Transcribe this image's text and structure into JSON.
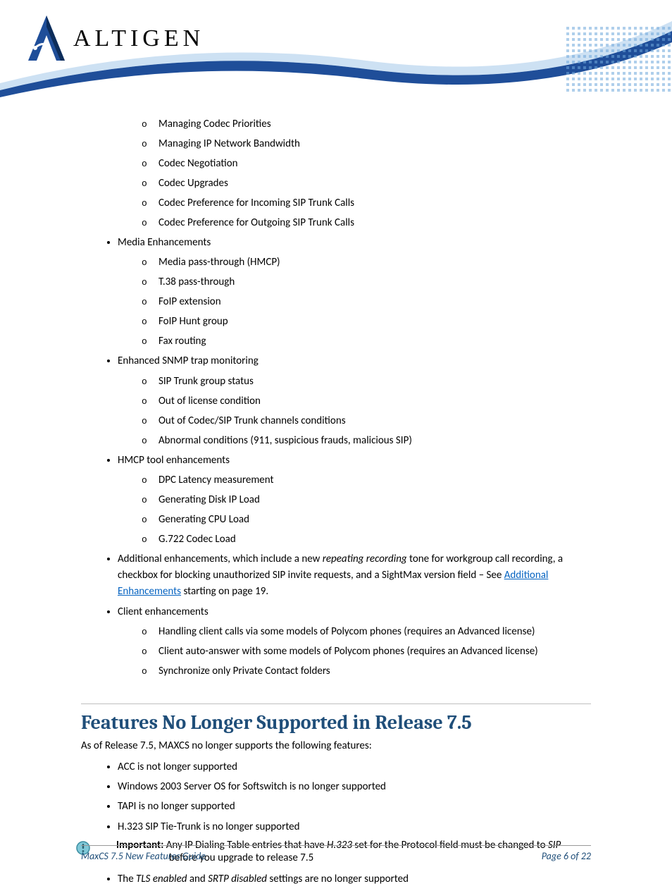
{
  "logo": {
    "text": "ALTIGEN"
  },
  "list1_sub": [
    "Managing Codec Priorities",
    "Managing IP Network Bandwidth",
    "Codec Negotiation",
    "Codec Upgrades",
    "Codec Preference for Incoming SIP Trunk Calls",
    "Codec Preference for Outgoing SIP Trunk Calls"
  ],
  "media": {
    "title": "Media Enhancements",
    "sub": [
      "Media pass-through (HMCP)",
      "T.38 pass-through",
      "FoIP extension",
      "FoIP Hunt group",
      "Fax routing"
    ]
  },
  "snmp": {
    "title": "Enhanced SNMP trap monitoring",
    "sub": [
      "SIP Trunk group status",
      "Out of license condition",
      "Out of Codec/SIP Trunk channels conditions",
      "Abnormal conditions (911, suspicious frauds, malicious SIP)"
    ]
  },
  "hmcp": {
    "title": "HMCP tool enhancements",
    "sub": [
      "DPC Latency measurement",
      "Generating Disk IP Load",
      "Generating CPU Load",
      "G.722 Codec Load"
    ]
  },
  "additional": {
    "pre": "Additional enhancements, which include a new ",
    "ital1": "repeating recording",
    "mid": " tone for workgroup call recording, a checkbox for blocking unauthorized SIP invite requests, and a SightMax version field – See ",
    "link": "Additional Enhancements",
    "post": " starting on page 19."
  },
  "client": {
    "title": "Client enhancements",
    "sub": [
      "Handling client calls via some models of Polycom phones (requires an Advanced license)",
      "Client auto-answer with some models of Polycom phones (requires an Advanced license)",
      "Synchronize only Private Contact folders"
    ]
  },
  "section2": {
    "heading": "Features No Longer Supported in Release 7.5",
    "intro": "As of Release 7.5, MAXCS no longer supports the following features:",
    "items_simple": [
      "ACC is not longer supported",
      "Windows 2003 Server OS for Softswitch is no longer supported",
      "TAPI is no longer supported",
      "H.323 SIP Tie-Trunk is no longer supported"
    ],
    "important": {
      "label": "Important:",
      "pre": "  Any IP Dialing Table entries that have ",
      "ital1": "H.323",
      "mid": " set for the Protocol field must be changed to ",
      "ital2": "SIP",
      "post": " before you upgrade to release 7.5"
    },
    "tls": {
      "pre": "The ",
      "ital1": "TLS enabled",
      "mid": " and ",
      "ital2": "SRTP disabled",
      "post": " settings are no longer supported"
    }
  },
  "footer": {
    "left": "MaxCS 7.5 New Features Guide",
    "right": "Page 6 of 22"
  }
}
